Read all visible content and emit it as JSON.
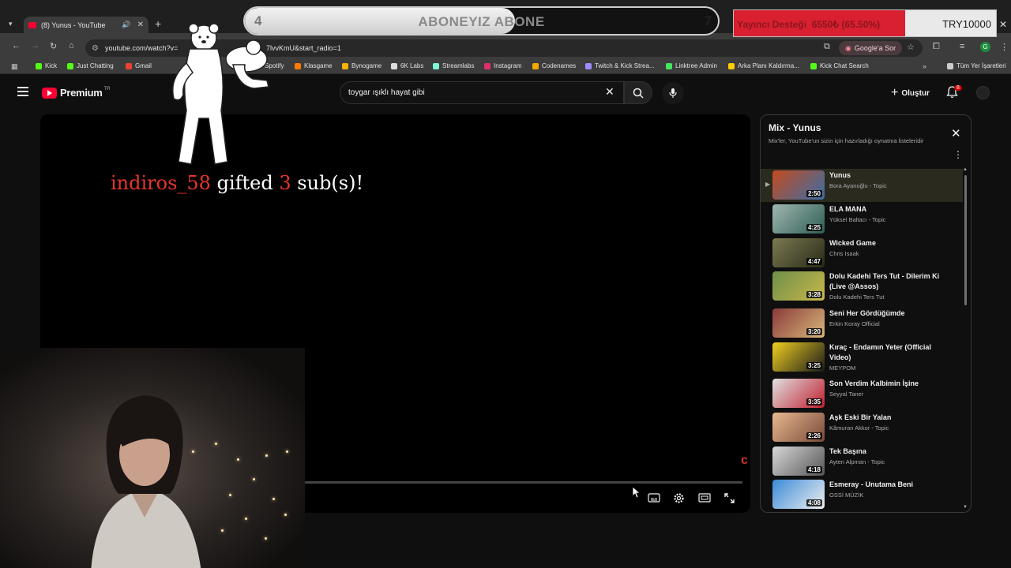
{
  "browser": {
    "tab_title": "(8) Yunus - YouTube",
    "tab_menu_icon": "chevron-down",
    "url": "youtube.com/watch?v=",
    "url_tail": "7lvvKmU&start_radio=1",
    "lens_label": "Google'a Sor",
    "profile_initial": "G",
    "bookmarks": [
      {
        "label": "Kick",
        "color": "#53fc18"
      },
      {
        "label": "Just Chatting",
        "color": "#53fc18"
      },
      {
        "label": "Gmail",
        "color": "#ea4335"
      },
      {
        "label": "Spotify",
        "color": "#1db954"
      },
      {
        "label": "Klasgame",
        "color": "#ff7a00"
      },
      {
        "label": "Bynogame",
        "color": "#f4b400"
      },
      {
        "label": "6K Labs",
        "color": "#dddddd"
      },
      {
        "label": "Streamlabs",
        "color": "#80f5d2"
      },
      {
        "label": "Instagram",
        "color": "#e1306c"
      },
      {
        "label": "Codenames",
        "color": "#f2a900"
      },
      {
        "label": "Twitch & Kick Strea...",
        "color": "#9b8cff"
      },
      {
        "label": "Linktree Admin",
        "color": "#43e660"
      },
      {
        "label": "Arka Planı Kaldırma...",
        "color": "#ffcc00"
      },
      {
        "label": "Kick Chat Search",
        "color": "#53fc18"
      },
      {
        "label": "Tüm Yer İşaretleri",
        "color": "#cccccc"
      }
    ]
  },
  "overlay": {
    "goal": {
      "current": "4",
      "label": "ABONEYIZ ABONE",
      "target": "7",
      "progress": 0.5714
    },
    "support": {
      "title": "Yayıncı Desteği",
      "amount_text": "6550₺ (65.50%)",
      "goal": "TRY10000",
      "progress": 0.655
    },
    "alert": {
      "user": "indiros_58",
      "verb": "gifted",
      "count": "3",
      "suffix": "sub(s)!"
    }
  },
  "youtube": {
    "logo_word": "Premium",
    "logo_country": "TR",
    "search_value": "toygar ışıklı hayat gibi",
    "create_label": "Oluştur",
    "notifications": "8",
    "playlist": {
      "title": "Mix - Yunus",
      "subtitle": "Mix'ler, YouTube'un sizin için hazırladığı oynatma listeleridir",
      "items": [
        {
          "title": "Yunus",
          "channel": "Bora Ayanoğlu - Topic",
          "duration": "2:50",
          "active": true,
          "thumb": [
            "#c44a20",
            "#3a6ea5"
          ]
        },
        {
          "title": "ELA MANA",
          "channel": "Yüksel Baltacı - Topic",
          "duration": "4:25",
          "thumb": [
            "#9fb7b0",
            "#2f5e55"
          ]
        },
        {
          "title": "Wicked Game",
          "channel": "Chris Isaak",
          "duration": "4:47",
          "thumb": [
            "#7a7a52",
            "#2a2a18"
          ]
        },
        {
          "title": "Dolu Kadehi Ters Tut - Dilerim Ki (Live @Assos)",
          "channel": "Dolu Kadehi Ters Tut",
          "duration": "3:28",
          "thumb": [
            "#6e8f4a",
            "#c9b84a"
          ]
        },
        {
          "title": "Seni Her Gördüğümde",
          "channel": "Erkin Koray Official",
          "duration": "3:20",
          "thumb": [
            "#8a3a3a",
            "#d8b87a"
          ]
        },
        {
          "title": "Kıraç - Endamın Yeter (Official Video)",
          "channel": "MEYPOM",
          "duration": "3:25",
          "thumb": [
            "#f0d020",
            "#1a1a1a"
          ]
        },
        {
          "title": "Son Verdim Kalbimin İşine",
          "channel": "Seyyal Taner",
          "duration": "3:35",
          "thumb": [
            "#e0e0e0",
            "#c02030"
          ]
        },
        {
          "title": "Aşk Eski Bir Yalan",
          "channel": "Kâmuran Akkor - Topic",
          "duration": "2:26",
          "thumb": [
            "#e8b890",
            "#7a4a3a"
          ]
        },
        {
          "title": "Tek Başına",
          "channel": "Ayten Alpman - Topic",
          "duration": "4:18",
          "thumb": [
            "#d8d8d8",
            "#555555"
          ]
        },
        {
          "title": "Esmeray - Unutama Beni",
          "channel": "OSSİ MÜZİK",
          "duration": "4:08",
          "thumb": [
            "#3a8ad8",
            "#f0f0f0"
          ]
        }
      ]
    }
  }
}
